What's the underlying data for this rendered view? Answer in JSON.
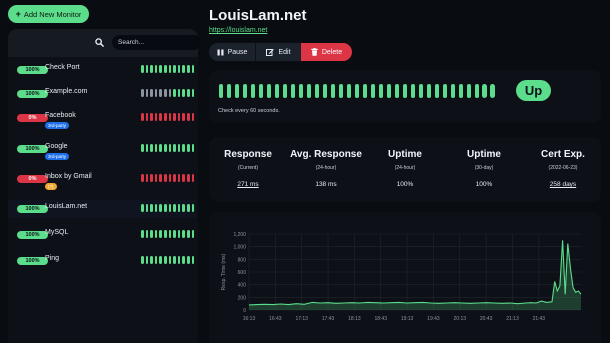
{
  "add_button": "Add New Monitor",
  "search": {
    "placeholder": "Search..."
  },
  "monitors": [
    {
      "name": "Check Port",
      "uptime": "100%",
      "status": "up",
      "tag": null,
      "beats": "gggggggggggg"
    },
    {
      "name": "Example.com",
      "uptime": "100%",
      "status": "up",
      "tag": null,
      "beats": "xxxxxxxggggg"
    },
    {
      "name": "Facebook",
      "uptime": "0%",
      "status": "down",
      "tag": {
        "label": "3rd-party",
        "color": "#1f6feb"
      },
      "beats": "rrrrrrrrrrrr"
    },
    {
      "name": "Google",
      "uptime": "100%",
      "status": "up",
      "tag": {
        "label": "3rd-party",
        "color": "#1f6feb"
      },
      "beats": "gggggggggggg"
    },
    {
      "name": "Inbox by Gmail",
      "uptime": "0%",
      "status": "down",
      "tag": {
        "label": "(?)",
        "color": "#f0a830"
      },
      "beats": "rrrrrrrrrrrr"
    },
    {
      "name": "LouisLam.net",
      "uptime": "100%",
      "status": "up",
      "tag": null,
      "beats": "gggggggggggg",
      "active": true
    },
    {
      "name": "MySQL",
      "uptime": "100%",
      "status": "up",
      "tag": null,
      "beats": "gggggggggggg"
    },
    {
      "name": "Ping",
      "uptime": "100%",
      "status": "up",
      "tag": null,
      "beats": "gggggggggggg"
    }
  ],
  "detail": {
    "title": "LouisLam.net",
    "url": "https://louislam.net",
    "buttons": {
      "pause": "Pause",
      "edit": "Edit",
      "delete": "Delete"
    },
    "status": "Up",
    "check_text": "Check every 60 seconds.",
    "stats": [
      {
        "label": "Response",
        "sub": "(Current)",
        "value": "271 ms",
        "link": true
      },
      {
        "label": "Avg. Response",
        "sub": "(24-hour)",
        "value": "138 ms",
        "link": false
      },
      {
        "label": "Uptime",
        "sub": "(24-hour)",
        "value": "100%",
        "link": false
      },
      {
        "label": "Uptime",
        "sub": "(30-day)",
        "value": "100%",
        "link": false
      },
      {
        "label": "Cert Exp.",
        "sub": "(2022-06-23)",
        "value": "258 days",
        "link": true
      }
    ]
  },
  "colors": {
    "accent": "#5cdd8b",
    "danger": "#dc3545",
    "pending": "#8b949e"
  },
  "chart_data": {
    "type": "area",
    "ylabel": "Resp. Time (ms)",
    "ylim": [
      0,
      1200
    ],
    "yticks": [
      "0",
      "200",
      "400",
      "600",
      "800",
      "1,000",
      "1,200"
    ],
    "xlabels": [
      "16:13",
      "16:43",
      "17:13",
      "17:43",
      "18:13",
      "18:43",
      "19:13",
      "19:43",
      "20:13",
      "20:43",
      "21:13",
      "21:43"
    ],
    "x": [
      0,
      0.3,
      0.6,
      0.9,
      1.2,
      1.5,
      1.8,
      2.1,
      2.4,
      2.7,
      3.0,
      3.3,
      3.6,
      3.9,
      4.2,
      4.5,
      4.8,
      5.1,
      5.4,
      5.7,
      6.0,
      6.3,
      6.6,
      6.9,
      7.2,
      7.5,
      7.8,
      8.1,
      8.4,
      8.7,
      9.0,
      9.3,
      9.6,
      9.9,
      10.2,
      10.5,
      10.7,
      10.9,
      11.1,
      11.3,
      11.5,
      11.6,
      11.7,
      11.8,
      11.9,
      12.0,
      12.1,
      12.2,
      12.3,
      12.4,
      12.5,
      12.6
    ],
    "y": [
      80,
      85,
      90,
      85,
      95,
      85,
      100,
      90,
      120,
      110,
      115,
      105,
      110,
      115,
      110,
      120,
      115,
      110,
      115,
      120,
      110,
      115,
      120,
      110,
      105,
      110,
      115,
      110,
      105,
      110,
      115,
      110,
      105,
      110,
      100,
      110,
      115,
      110,
      140,
      120,
      130,
      450,
      300,
      380,
      1100,
      250,
      1050,
      650,
      350,
      280,
      300,
      250
    ]
  }
}
